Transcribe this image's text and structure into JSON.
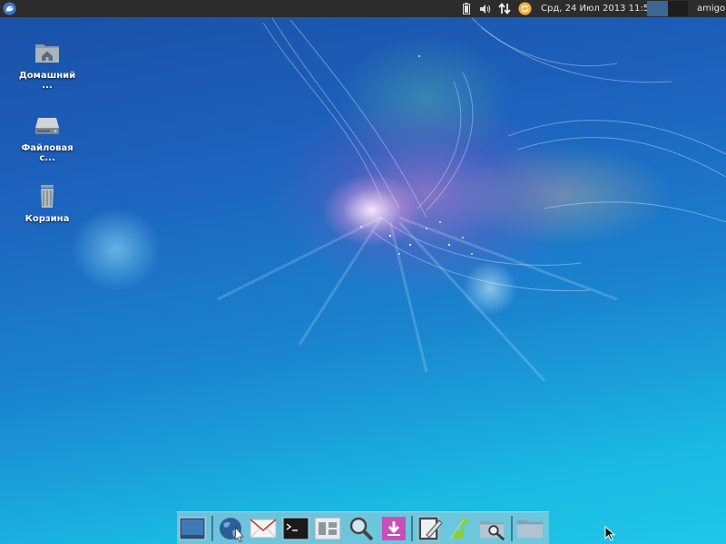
{
  "topbar": {
    "menu_icon": "xfce-mouse-icon",
    "clock": "Срд, 24 Июл 2013 11:53",
    "user": "amigo",
    "tray_icons": [
      "battery-icon",
      "volume-icon",
      "network-icon",
      "updates-icon"
    ]
  },
  "desktop": {
    "icons": [
      {
        "label": "Домашний ...",
        "icon": "home-folder-icon"
      },
      {
        "label": "Файловая с...",
        "icon": "drive-icon"
      },
      {
        "label": "Корзина",
        "icon": "trash-icon"
      }
    ]
  },
  "dock": {
    "items": [
      "show-desktop-icon",
      "web-browser-icon",
      "mail-icon",
      "terminal-icon",
      "file-manager-icon",
      "search-icon",
      "download-icon",
      "text-editor-icon",
      "music-player-icon",
      "image-viewer-icon",
      "folder-icon"
    ]
  },
  "colors": {
    "topbar_bg": "#2c2c2c",
    "workspace_active": "#3d6694",
    "workspace_inactive": "#1d1d1d"
  }
}
